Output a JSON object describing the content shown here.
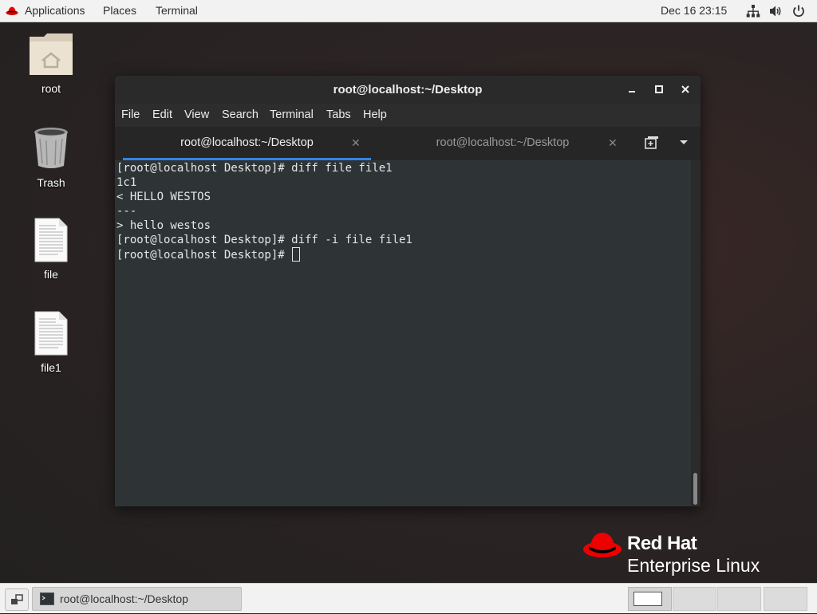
{
  "topbar": {
    "applications": "Applications",
    "places": "Places",
    "terminal": "Terminal",
    "clock": "Dec 16  23:15",
    "tray_icons": [
      "network-icon",
      "volume-icon",
      "power-icon"
    ]
  },
  "desktop": {
    "icons": [
      {
        "label": "root",
        "icon": "home-folder-icon"
      },
      {
        "label": "Trash",
        "icon": "trash-icon"
      },
      {
        "label": "file",
        "icon": "text-file-icon"
      },
      {
        "label": "file1",
        "icon": "text-file-icon"
      }
    ]
  },
  "window": {
    "title": "root@localhost:~/Desktop",
    "menu": [
      "File",
      "Edit",
      "View",
      "Search",
      "Terminal",
      "Tabs",
      "Help"
    ],
    "tabs": [
      {
        "label": "root@localhost:~/Desktop",
        "active": true
      },
      {
        "label": "root@localhost:~/Desktop",
        "active": false
      }
    ],
    "terminal_lines": [
      "[root@localhost Desktop]# diff file file1",
      "1c1",
      "< HELLO WESTOS",
      "---",
      "> hello westos",
      "[root@localhost Desktop]# diff -i file file1",
      "[root@localhost Desktop]# "
    ]
  },
  "branding": {
    "line1": "Red Hat",
    "line2": "Enterprise Linux",
    "accent": "#ee0000"
  },
  "taskbar": {
    "item_label": "root@localhost:~/Desktop",
    "workspaces": 4,
    "active_workspace": 1
  }
}
